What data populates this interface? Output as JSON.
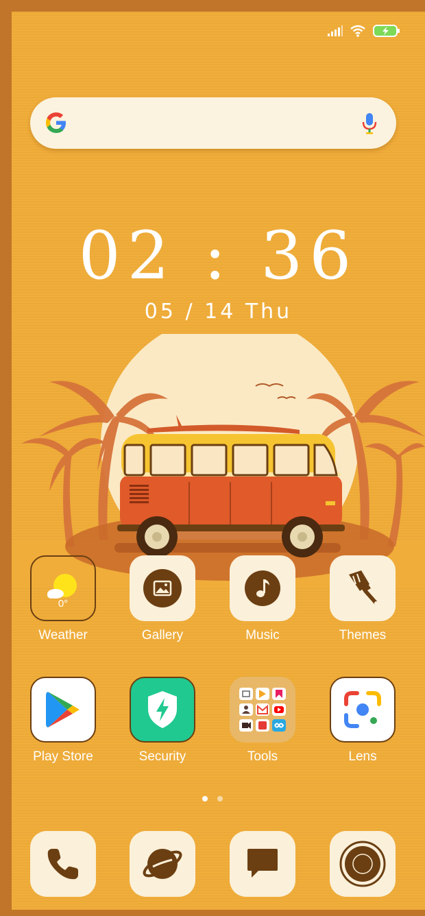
{
  "status_bar": {
    "icons": [
      "signal-icon",
      "wifi-icon",
      "battery-charging-icon"
    ]
  },
  "search_bar": {
    "logo": "google-logo",
    "mic": "microphone-icon"
  },
  "clock": {
    "time": "02 : 36",
    "date": "05 / 14   Thu"
  },
  "apps_row1": [
    {
      "label": "Weather",
      "temp": "0°",
      "icon": "weather-icon"
    },
    {
      "label": "Gallery",
      "icon": "gallery-icon"
    },
    {
      "label": "Music",
      "icon": "music-icon"
    },
    {
      "label": "Themes",
      "icon": "themes-icon"
    }
  ],
  "apps_row2": [
    {
      "label": "Play Store",
      "icon": "play-store-icon"
    },
    {
      "label": "Security",
      "icon": "security-icon"
    },
    {
      "label": "Tools",
      "icon": "tools-folder-icon"
    },
    {
      "label": "Lens",
      "icon": "lens-icon"
    }
  ],
  "page_indicator": {
    "pages": 2,
    "active": 1
  },
  "dock": [
    {
      "icon": "phone-icon"
    },
    {
      "icon": "browser-icon"
    },
    {
      "icon": "messages-icon"
    },
    {
      "icon": "camera-icon"
    }
  ],
  "colors": {
    "wallpaper": "#f0ad3a",
    "frame": "#c0752a",
    "tile": "#fbf0da",
    "icon_dark": "#6b3f12"
  }
}
